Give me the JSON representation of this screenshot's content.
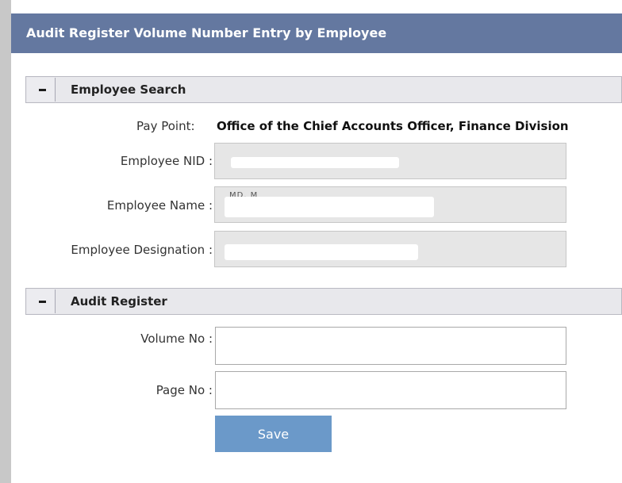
{
  "page": {
    "title": "Audit Register Volume Number Entry by Employee"
  },
  "employee_search": {
    "section_title": "Employee Search",
    "pay_point_label": "Pay Point:",
    "pay_point_value": "Office of the Chief Accounts Officer, Finance Division",
    "nid_label": "Employee NID :",
    "nid_value": "",
    "name_label": "Employee Name :",
    "name_value": "MD. M",
    "designation_label": "Employee Designation :",
    "designation_value": ""
  },
  "audit_register": {
    "section_title": "Audit Register",
    "volume_label": "Volume No :",
    "volume_value": "",
    "page_label": "Page No :",
    "page_value": ""
  },
  "actions": {
    "save_label": "Save"
  },
  "colors": {
    "title_bar": "#6478a0",
    "save_button": "#6b99c9",
    "readonly_field": "#e6e6e6"
  }
}
